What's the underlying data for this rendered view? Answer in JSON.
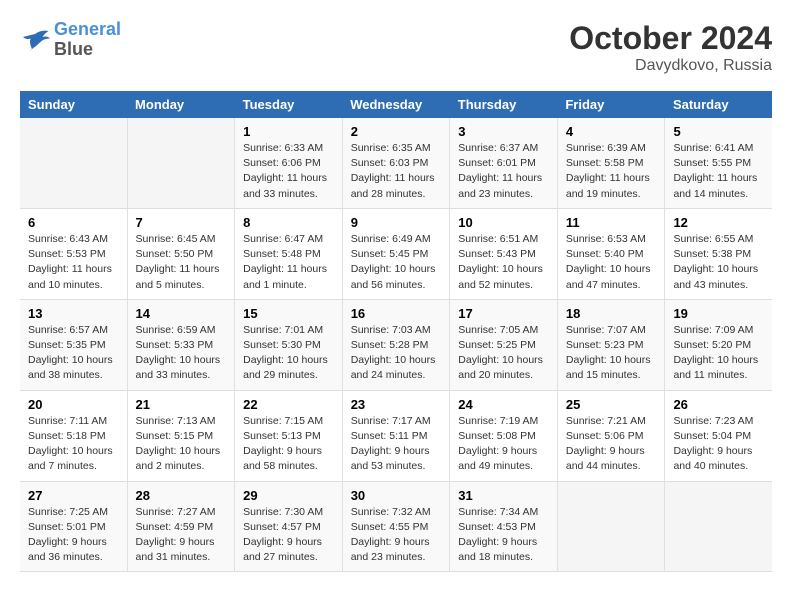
{
  "header": {
    "logo_line1": "General",
    "logo_line2": "Blue",
    "title": "October 2024",
    "subtitle": "Davydkovo, Russia"
  },
  "weekdays": [
    "Sunday",
    "Monday",
    "Tuesday",
    "Wednesday",
    "Thursday",
    "Friday",
    "Saturday"
  ],
  "weeks": [
    [
      {
        "day": "",
        "info": ""
      },
      {
        "day": "",
        "info": ""
      },
      {
        "day": "1",
        "info": "Sunrise: 6:33 AM\nSunset: 6:06 PM\nDaylight: 11 hours\nand 33 minutes."
      },
      {
        "day": "2",
        "info": "Sunrise: 6:35 AM\nSunset: 6:03 PM\nDaylight: 11 hours\nand 28 minutes."
      },
      {
        "day": "3",
        "info": "Sunrise: 6:37 AM\nSunset: 6:01 PM\nDaylight: 11 hours\nand 23 minutes."
      },
      {
        "day": "4",
        "info": "Sunrise: 6:39 AM\nSunset: 5:58 PM\nDaylight: 11 hours\nand 19 minutes."
      },
      {
        "day": "5",
        "info": "Sunrise: 6:41 AM\nSunset: 5:55 PM\nDaylight: 11 hours\nand 14 minutes."
      }
    ],
    [
      {
        "day": "6",
        "info": "Sunrise: 6:43 AM\nSunset: 5:53 PM\nDaylight: 11 hours\nand 10 minutes."
      },
      {
        "day": "7",
        "info": "Sunrise: 6:45 AM\nSunset: 5:50 PM\nDaylight: 11 hours\nand 5 minutes."
      },
      {
        "day": "8",
        "info": "Sunrise: 6:47 AM\nSunset: 5:48 PM\nDaylight: 11 hours\nand 1 minute."
      },
      {
        "day": "9",
        "info": "Sunrise: 6:49 AM\nSunset: 5:45 PM\nDaylight: 10 hours\nand 56 minutes."
      },
      {
        "day": "10",
        "info": "Sunrise: 6:51 AM\nSunset: 5:43 PM\nDaylight: 10 hours\nand 52 minutes."
      },
      {
        "day": "11",
        "info": "Sunrise: 6:53 AM\nSunset: 5:40 PM\nDaylight: 10 hours\nand 47 minutes."
      },
      {
        "day": "12",
        "info": "Sunrise: 6:55 AM\nSunset: 5:38 PM\nDaylight: 10 hours\nand 43 minutes."
      }
    ],
    [
      {
        "day": "13",
        "info": "Sunrise: 6:57 AM\nSunset: 5:35 PM\nDaylight: 10 hours\nand 38 minutes."
      },
      {
        "day": "14",
        "info": "Sunrise: 6:59 AM\nSunset: 5:33 PM\nDaylight: 10 hours\nand 33 minutes."
      },
      {
        "day": "15",
        "info": "Sunrise: 7:01 AM\nSunset: 5:30 PM\nDaylight: 10 hours\nand 29 minutes."
      },
      {
        "day": "16",
        "info": "Sunrise: 7:03 AM\nSunset: 5:28 PM\nDaylight: 10 hours\nand 24 minutes."
      },
      {
        "day": "17",
        "info": "Sunrise: 7:05 AM\nSunset: 5:25 PM\nDaylight: 10 hours\nand 20 minutes."
      },
      {
        "day": "18",
        "info": "Sunrise: 7:07 AM\nSunset: 5:23 PM\nDaylight: 10 hours\nand 15 minutes."
      },
      {
        "day": "19",
        "info": "Sunrise: 7:09 AM\nSunset: 5:20 PM\nDaylight: 10 hours\nand 11 minutes."
      }
    ],
    [
      {
        "day": "20",
        "info": "Sunrise: 7:11 AM\nSunset: 5:18 PM\nDaylight: 10 hours\nand 7 minutes."
      },
      {
        "day": "21",
        "info": "Sunrise: 7:13 AM\nSunset: 5:15 PM\nDaylight: 10 hours\nand 2 minutes."
      },
      {
        "day": "22",
        "info": "Sunrise: 7:15 AM\nSunset: 5:13 PM\nDaylight: 9 hours\nand 58 minutes."
      },
      {
        "day": "23",
        "info": "Sunrise: 7:17 AM\nSunset: 5:11 PM\nDaylight: 9 hours\nand 53 minutes."
      },
      {
        "day": "24",
        "info": "Sunrise: 7:19 AM\nSunset: 5:08 PM\nDaylight: 9 hours\nand 49 minutes."
      },
      {
        "day": "25",
        "info": "Sunrise: 7:21 AM\nSunset: 5:06 PM\nDaylight: 9 hours\nand 44 minutes."
      },
      {
        "day": "26",
        "info": "Sunrise: 7:23 AM\nSunset: 5:04 PM\nDaylight: 9 hours\nand 40 minutes."
      }
    ],
    [
      {
        "day": "27",
        "info": "Sunrise: 7:25 AM\nSunset: 5:01 PM\nDaylight: 9 hours\nand 36 minutes."
      },
      {
        "day": "28",
        "info": "Sunrise: 7:27 AM\nSunset: 4:59 PM\nDaylight: 9 hours\nand 31 minutes."
      },
      {
        "day": "29",
        "info": "Sunrise: 7:30 AM\nSunset: 4:57 PM\nDaylight: 9 hours\nand 27 minutes."
      },
      {
        "day": "30",
        "info": "Sunrise: 7:32 AM\nSunset: 4:55 PM\nDaylight: 9 hours\nand 23 minutes."
      },
      {
        "day": "31",
        "info": "Sunrise: 7:34 AM\nSunset: 4:53 PM\nDaylight: 9 hours\nand 18 minutes."
      },
      {
        "day": "",
        "info": ""
      },
      {
        "day": "",
        "info": ""
      }
    ]
  ]
}
